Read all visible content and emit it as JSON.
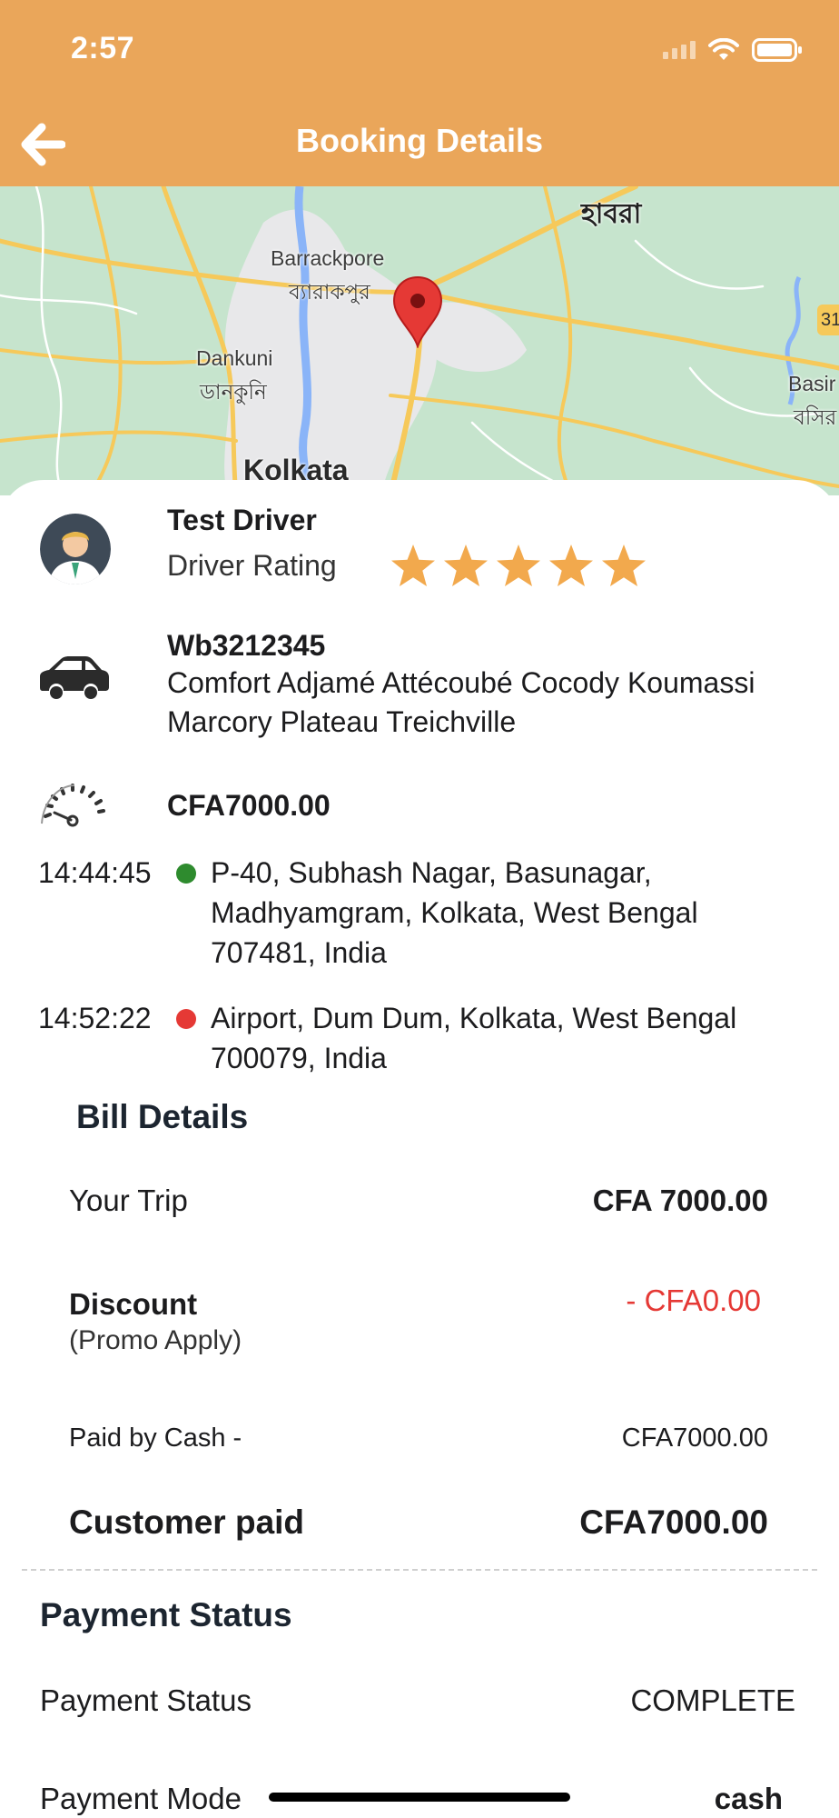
{
  "status_bar": {
    "time": "2:57"
  },
  "header": {
    "title": "Booking Details",
    "back_icon": "arrow-left-icon"
  },
  "map": {
    "labels": {
      "howrah_bn": "হাবরা",
      "barrackpore": "Barrackpore",
      "barrackpore_bn": "ব্যারাকপুর",
      "dankuni": "Dankuni",
      "dankuni_bn": "ডানকুনি",
      "kolkata": "Kolkata",
      "basirhat": "Basir",
      "basirhat_bn": "বসির",
      "road_badge": "31"
    },
    "colors": {
      "land": "#c6e4cd",
      "urban": "#e8e8ea",
      "road_major": "#f6c95a",
      "water": "#8ab4f8",
      "pin": "#e53935"
    }
  },
  "driver": {
    "name": "Test Driver",
    "rating_label": "Driver Rating",
    "rating": 5,
    "rating_max": 5
  },
  "vehicle": {
    "plate": "Wb3212345",
    "description": "Comfort Adjamé Attécoubé Cocody Koumassi Marcory Plateau Treichville"
  },
  "fare": {
    "amount": "CFA7000.00"
  },
  "stops": [
    {
      "time": "14:44:45",
      "color": "#2e8b2e",
      "address": "P-40, Subhash Nagar, Basunagar, Madhyamgram, Kolkata, West Bengal 707481, India"
    },
    {
      "time": "14:52:22",
      "color": "#e53935",
      "address": "Airport, Dum Dum, Kolkata, West Bengal 700079, India"
    }
  ],
  "bill": {
    "title": "Bill Details",
    "your_trip_label": "Your Trip",
    "your_trip_value": "CFA 7000.00",
    "discount_label": "Discount",
    "discount_sub": "(Promo Apply)",
    "discount_value": "- CFA0.00",
    "paid_by_label": "Paid by Cash -",
    "paid_by_value": "CFA7000.00",
    "customer_paid_label": "Customer paid",
    "customer_paid_value": "CFA7000.00"
  },
  "payment": {
    "title": "Payment Status",
    "status_label": "Payment Status",
    "status_value": "COMPLETE",
    "mode_label": "Payment Mode",
    "mode_value": "cash"
  },
  "theme": {
    "accent": "#eaa65a",
    "star": "#f2a94d",
    "danger": "#e53935"
  }
}
